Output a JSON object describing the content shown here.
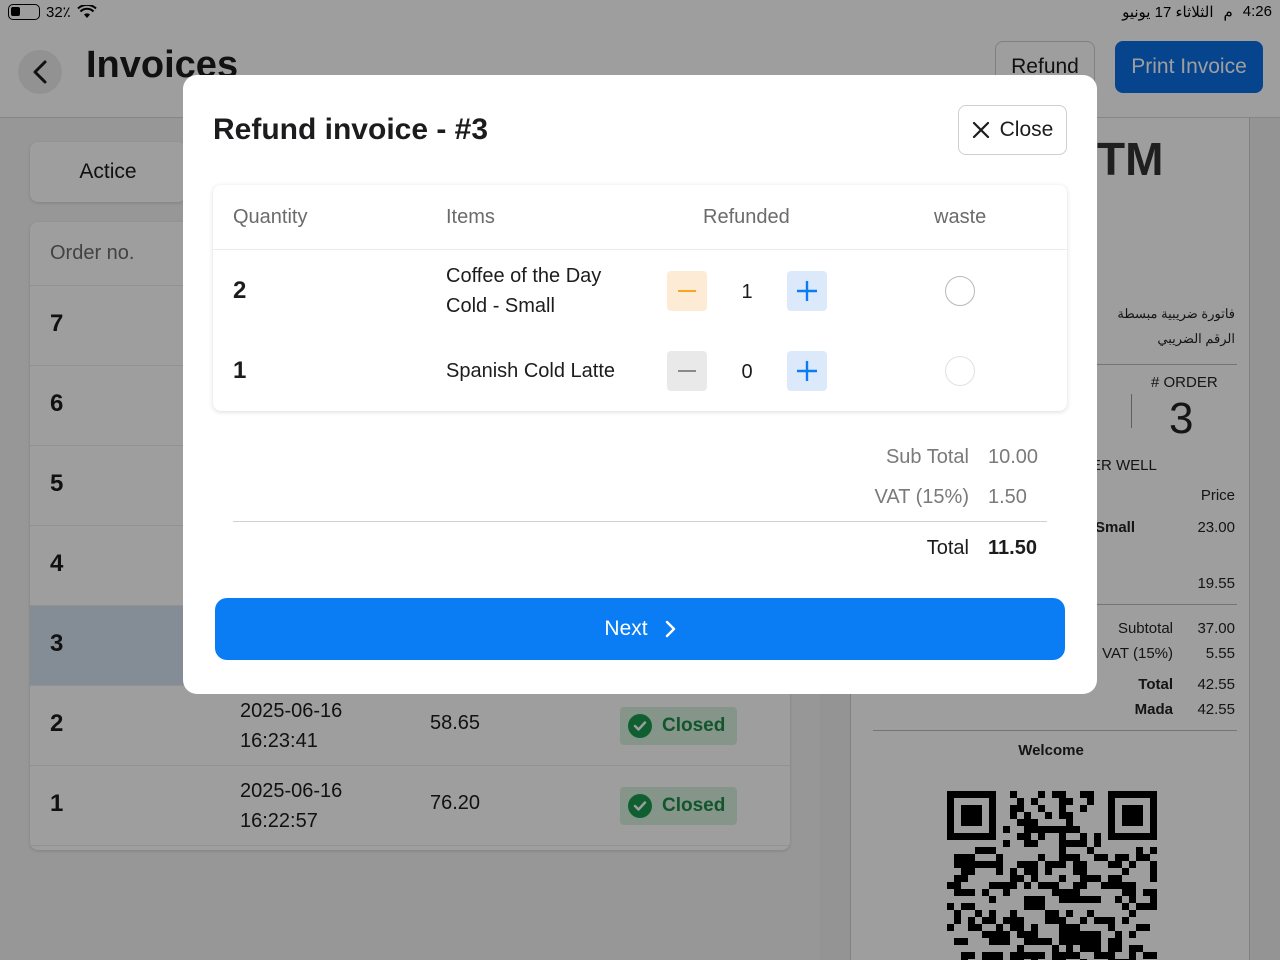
{
  "status_bar": {
    "battery": "32٪",
    "time": "4:26",
    "period": "م",
    "date": "الثلاثاء 17 يونيو"
  },
  "header": {
    "title": "Invoices",
    "refund_label": "Refund",
    "print_label": "Print Invoice",
    "accent_color": "#0a6ee6"
  },
  "filters": {
    "active_tab": "Actice"
  },
  "list": {
    "column_order": "Order no.",
    "rows": [
      {
        "order": "7",
        "date": "",
        "time": "",
        "amount": "",
        "status": ""
      },
      {
        "order": "6",
        "date": "",
        "time": "",
        "amount": "",
        "status": ""
      },
      {
        "order": "5",
        "date": "",
        "time": "",
        "amount": "",
        "status": ""
      },
      {
        "order": "4",
        "date": "",
        "time": "",
        "amount": "",
        "status": ""
      },
      {
        "order": "3",
        "date": "",
        "time": "",
        "amount": "",
        "status": "",
        "selected": true
      },
      {
        "order": "2",
        "date": "2025-06-16",
        "time": "16:23:41",
        "amount": "58.65",
        "status": "Closed"
      },
      {
        "order": "1",
        "date": "2025-06-16",
        "time": "16:22:57",
        "amount": "76.20",
        "status": "Closed"
      }
    ]
  },
  "receipt": {
    "logo_fragment": "TM",
    "invoice_type_ar": "فاتورة ضريبية مبسطة",
    "vat_number_label_ar": "الرقم الضريبي",
    "order_label": "# ORDER",
    "order_number": "3",
    "cashier_fragment": "ER WELL",
    "price_header": "Price",
    "item_fragment": "Small",
    "item_price": "23.00",
    "second_price": "19.55",
    "subtotal_label": "Subtotal",
    "subtotal": "37.00",
    "vat_label": "VAT (15%)",
    "vat": "5.55",
    "total_label": "Total",
    "total": "42.55",
    "payment_label": "Mada",
    "payment": "42.55",
    "welcome": "Welcome"
  },
  "modal": {
    "title": "Refund invoice - #3",
    "close_label": "Close",
    "columns": {
      "quantity": "Quantity",
      "items": "Items",
      "refunded": "Refunded",
      "waste": "waste"
    },
    "items": [
      {
        "quantity": "2",
        "name_line1": "Coffee of the Day",
        "name_line2": "Cold - Small",
        "refunded": "1",
        "waste": false
      },
      {
        "quantity": "1",
        "name_line1": "Spanish Cold Latte",
        "name_line2": "",
        "refunded": "0",
        "waste": false
      }
    ],
    "summary": {
      "subtotal_label": "Sub Total",
      "subtotal": "10.00",
      "vat_label": "VAT (15%)",
      "vat": "1.50",
      "total_label": "Total",
      "total": "11.50"
    },
    "next_label": "Next",
    "colors": {
      "primary": "#0a7cf4",
      "minus_active": "#f5a623",
      "closed_badge": "#1a9a4f"
    }
  }
}
